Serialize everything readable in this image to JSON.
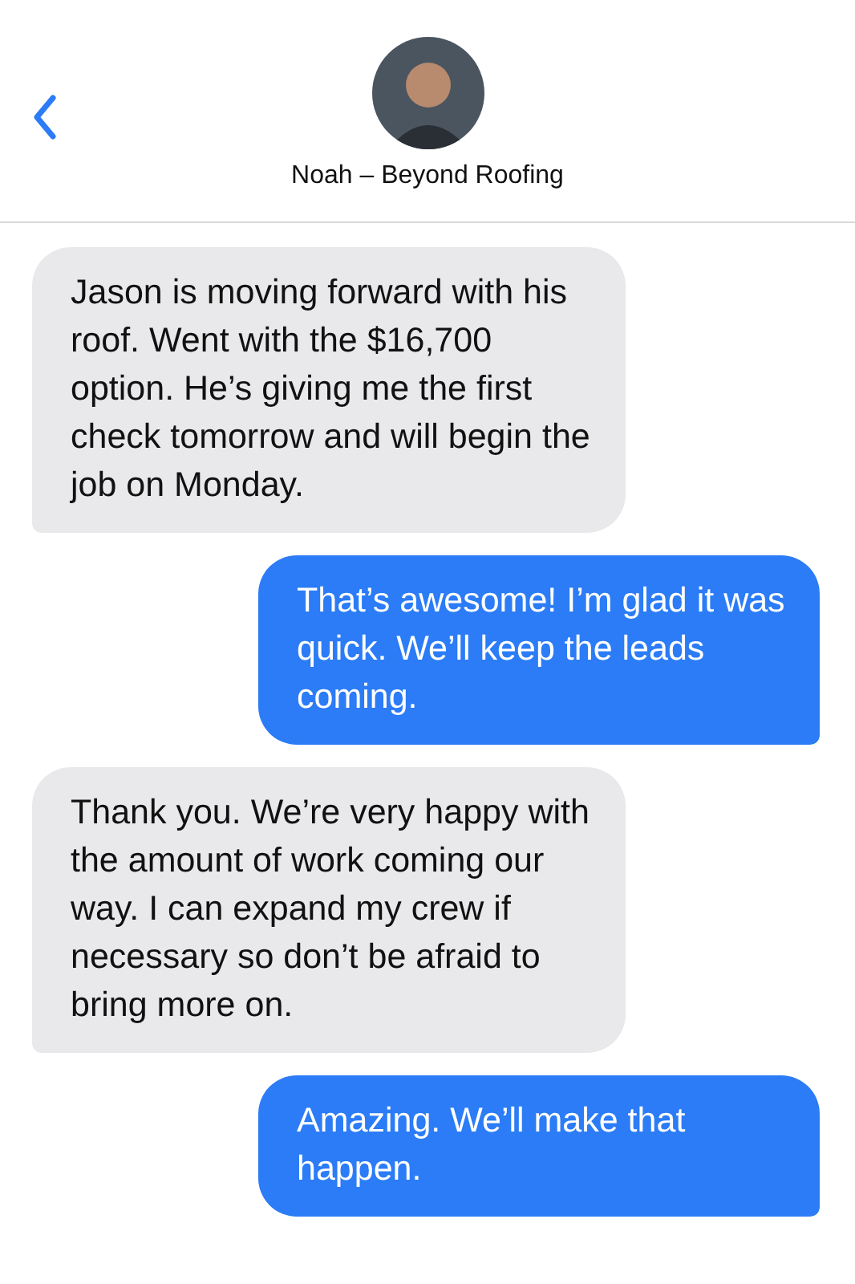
{
  "header": {
    "contact_name": "Noah – Beyond Roofing"
  },
  "messages": [
    {
      "kind": "received",
      "text": "Jason is moving forward with his roof. Went with the $16,700 option. He’s giving me the first check tomorrow and will begin the job on Monday."
    },
    {
      "kind": "sent",
      "text": "That’s awesome! I’m glad it was quick. We’ll keep the leads coming."
    },
    {
      "kind": "received",
      "text": "Thank you. We’re very happy with the amount of work coming our way. I can expand my crew if necessary so don’t be afraid to bring more on."
    },
    {
      "kind": "sent",
      "text": "Amazing. We’ll make that happen."
    }
  ]
}
